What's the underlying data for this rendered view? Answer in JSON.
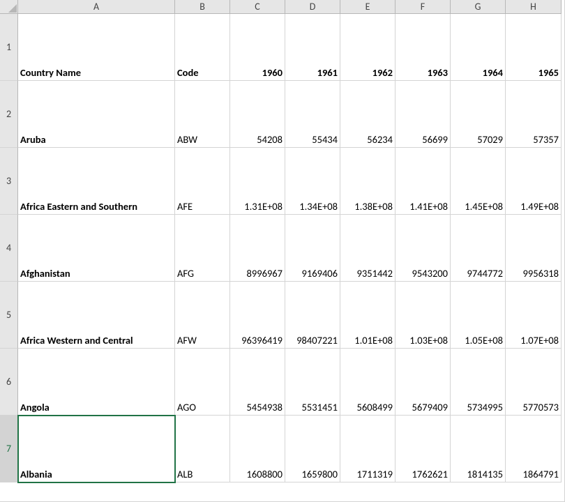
{
  "columns": [
    "A",
    "B",
    "C",
    "D",
    "E",
    "F",
    "G",
    "H"
  ],
  "row_numbers": [
    1,
    2,
    3,
    4,
    5,
    6,
    7
  ],
  "active_row": 7,
  "selected_cell": {
    "row": 7,
    "col": "A"
  },
  "header_row": {
    "country_name": "Country Name",
    "code": "Code",
    "y1960": "1960",
    "y1961": "1961",
    "y1962": "1962",
    "y1963": "1963",
    "y1964": "1964",
    "y1965": "1965"
  },
  "rows": [
    {
      "country": "Aruba",
      "code": "ABW",
      "v": [
        "54208",
        "55434",
        "56234",
        "56699",
        "57029",
        "57357"
      ]
    },
    {
      "country": "Africa Eastern and Southern",
      "code": "AFE",
      "v": [
        "1.31E+08",
        "1.34E+08",
        "1.38E+08",
        "1.41E+08",
        "1.45E+08",
        "1.49E+08"
      ]
    },
    {
      "country": "Afghanistan",
      "code": "AFG",
      "v": [
        "8996967",
        "9169406",
        "9351442",
        "9543200",
        "9744772",
        "9956318"
      ]
    },
    {
      "country": "Africa Western and Central",
      "code": "AFW",
      "v": [
        "96396419",
        "98407221",
        "1.01E+08",
        "1.03E+08",
        "1.05E+08",
        "1.07E+08"
      ]
    },
    {
      "country": "Angola",
      "code": "AGO",
      "v": [
        "5454938",
        "5531451",
        "5608499",
        "5679409",
        "5734995",
        "5770573"
      ]
    },
    {
      "country": "Albania",
      "code": "ALB",
      "v": [
        "1608800",
        "1659800",
        "1711319",
        "1762621",
        "1814135",
        "1864791"
      ]
    }
  ]
}
